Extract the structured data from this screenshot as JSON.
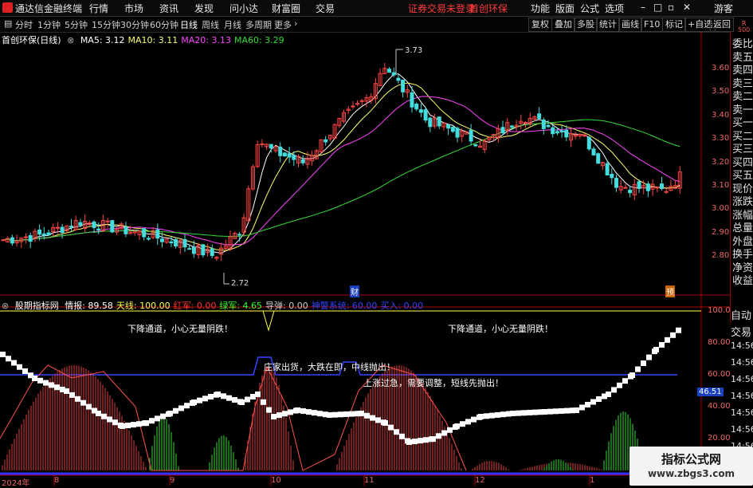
{
  "menubar": {
    "app_title": "通达信金融终端",
    "menu": [
      "行情",
      "市场",
      "资讯",
      "发现",
      "问小达",
      "财富圈",
      "交易"
    ],
    "login_notice": "证券交易未登录",
    "stock_name": "首创环保",
    "right_menu": [
      "功能",
      "版面",
      "公式",
      "选项"
    ],
    "guest": "游客"
  },
  "timeframes": [
    "分时",
    "1分钟",
    "5分钟",
    "15分钟",
    "30分钟",
    "60分钟",
    "日线",
    "周线",
    "月线",
    "多周期",
    "更多"
  ],
  "active_timeframe": "日线",
  "toolbar_buttons": [
    "复权",
    "叠加",
    "多股",
    "统计",
    "画线",
    "F10",
    "标记",
    "+自选",
    "返回"
  ],
  "kline_info": {
    "title": "首创环保(日线)",
    "ma": [
      {
        "label": "MA5:",
        "value": "3.12",
        "color": "#ffffff"
      },
      {
        "label": "MA10:",
        "value": "3.11",
        "color": "#ffff66"
      },
      {
        "label": "MA20:",
        "value": "3.13",
        "color": "#ff44ff"
      },
      {
        "label": "MA60:",
        "value": "3.29",
        "color": "#33dd33"
      }
    ]
  },
  "price_axis": [
    "3.60",
    "3.50",
    "3.40",
    "3.30",
    "3.20",
    "3.10",
    "3.00",
    "2.90",
    "2.80"
  ],
  "price_high_label": "3.73",
  "price_low_label": "2.72",
  "event_markers": [
    "财",
    "预"
  ],
  "right_panel": {
    "corner": "R\n500",
    "items": [
      "委比",
      "卖五",
      "卖四",
      "卖三",
      "卖二",
      "卖一",
      "买一",
      "买二",
      "买三",
      "买四",
      "买五",
      "现价",
      "涨跌",
      "涨幅",
      "总量",
      "外盘",
      "换手",
      "净资",
      "收益"
    ]
  },
  "indicator_info": {
    "name": "股期指标网",
    "values": [
      {
        "label": "情报:",
        "value": "89.58",
        "color": "#ffffff"
      },
      {
        "label": "天线:",
        "value": "100.00",
        "color": "#ffff44"
      },
      {
        "label": "红军:",
        "value": "0.00",
        "color": "#ff3333"
      },
      {
        "label": "绿军:",
        "value": "4.65",
        "color": "#33ff33"
      },
      {
        "label": "导弹:",
        "value": "0.00",
        "color": "#cccccc"
      },
      {
        "label": "神警系统:",
        "value": "60.00",
        "color": "#3344ff"
      },
      {
        "label": "买入:",
        "value": "0.00",
        "color": "#3344ff"
      }
    ]
  },
  "indicator_axis": [
    "100.0",
    "80.00",
    "60.00",
    "40.00",
    "20.00"
  ],
  "indicator_current": "46.51",
  "indicator_right": [
    "自动",
    "交易",
    "14:56",
    "14:56",
    "14:56",
    "14:56",
    "14:56",
    "14:56",
    "14:56",
    "14:56"
  ],
  "notes": {
    "note1": "下降通道，小心无量阴跌！",
    "note2": "下降通道，小心无量阴跌！",
    "note3": "庄家出货，大跌在即，中线抛出！",
    "note4": "上涨过急，需要调整，短线先抛出！"
  },
  "time_axis": [
    "2024年",
    "8",
    "9",
    "10",
    "11",
    "12",
    "1"
  ],
  "watermark": {
    "line1": "指标公式网",
    "line2": "www.zbgs3.com"
  }
}
